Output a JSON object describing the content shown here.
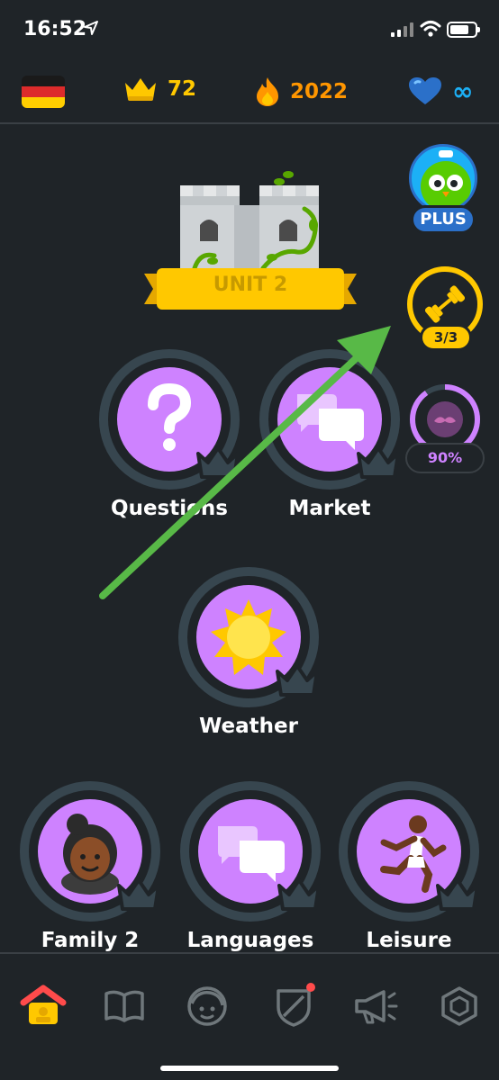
{
  "status_bar": {
    "time": "16:52"
  },
  "topbar": {
    "language_flag": "germany-flag",
    "crowns": "72",
    "streak": "2022",
    "hearts": "∞",
    "colors": {
      "crown": "#ffc800",
      "streak": "#ff9600",
      "hearts": "#1cb0f6"
    }
  },
  "right_column": {
    "plus_label": "PLUS",
    "practice_label": "3/3",
    "legendary_label": "90%"
  },
  "unit": {
    "label": "UNIT 2"
  },
  "skills": [
    {
      "name": "Questions",
      "icon": "question-mark-icon"
    },
    {
      "name": "Market",
      "icon": "speech-bubbles-icon"
    },
    {
      "name": "Weather",
      "icon": "sun-icon"
    },
    {
      "name": "Family 2",
      "icon": "person-face-icon"
    },
    {
      "name": "Languages",
      "icon": "speech-bubbles-icon"
    },
    {
      "name": "Leisure",
      "icon": "running-person-icon"
    }
  ],
  "bottom_nav": [
    {
      "name": "home",
      "icon": "home-icon",
      "active": true
    },
    {
      "name": "stories",
      "icon": "book-icon"
    },
    {
      "name": "profile",
      "icon": "avatar-icon"
    },
    {
      "name": "leagues",
      "icon": "shield-icon",
      "notification": true
    },
    {
      "name": "news",
      "icon": "megaphone-icon"
    },
    {
      "name": "shop",
      "icon": "gem-icon"
    }
  ],
  "colors": {
    "background": "#1f2428",
    "skill_purple": "#ce82ff",
    "arrow_green": "#58b947"
  }
}
